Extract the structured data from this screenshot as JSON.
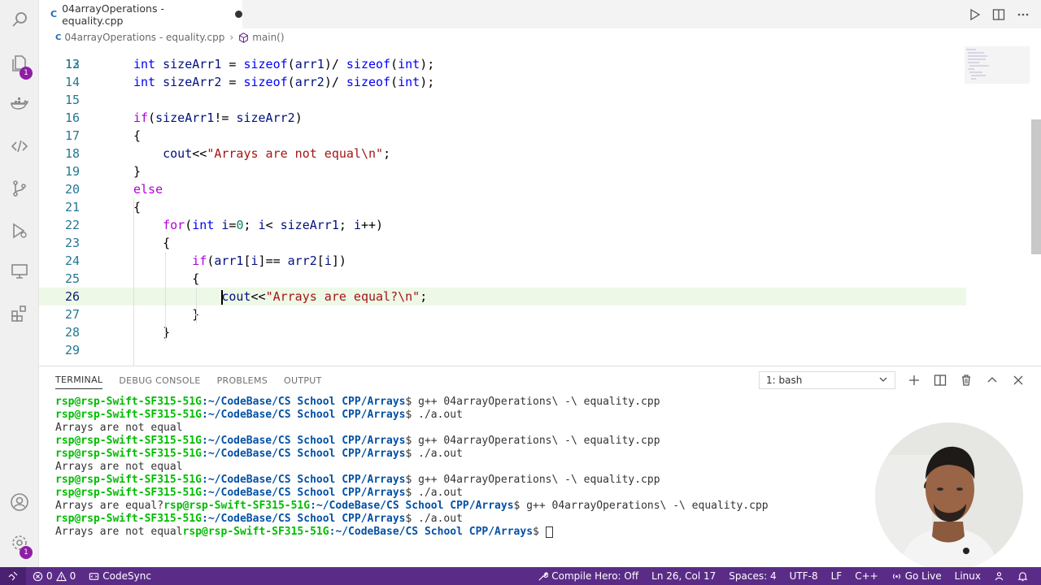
{
  "tab": {
    "icon": "C",
    "title": "04arrayOperations - equality.cpp"
  },
  "breadcrumb": {
    "file": "04arrayOperations - equality.cpp",
    "symbol": "main()"
  },
  "editor": {
    "top_partial": "12",
    "lines": [
      {
        "n": "13",
        "t": "int sizeArr1 = sizeof(arr1)/ sizeof(int);"
      },
      {
        "n": "14",
        "t": "int sizeArr2 = sizeof(arr2)/ sizeof(int);"
      },
      {
        "n": "15",
        "t": ""
      },
      {
        "n": "16",
        "t": "if(sizeArr1!= sizeArr2)"
      },
      {
        "n": "17",
        "t": "{"
      },
      {
        "n": "18",
        "t": "    cout<<\"Arrays are not equal\\n\";"
      },
      {
        "n": "19",
        "t": "}"
      },
      {
        "n": "20",
        "t": "else"
      },
      {
        "n": "21",
        "t": "{"
      },
      {
        "n": "22",
        "t": "    for(int i=0; i< sizeArr1; i++)"
      },
      {
        "n": "23",
        "t": "    {"
      },
      {
        "n": "24",
        "t": "        if(arr1[i]== arr2[i])"
      },
      {
        "n": "25",
        "t": "        {"
      },
      {
        "n": "26",
        "t": "            cout<<\"Arrays are equal?\\n\";"
      },
      {
        "n": "27",
        "t": "        }"
      },
      {
        "n": "28",
        "t": "    }"
      },
      {
        "n": "29",
        "t": ""
      }
    ],
    "current_line": "26"
  },
  "panel": {
    "tabs": [
      "TERMINAL",
      "DEBUG CONSOLE",
      "PROBLEMS",
      "OUTPUT"
    ],
    "active_tab": "TERMINAL",
    "terminal_select": "1: bash"
  },
  "terminal": {
    "prompt": "rsp@rsp-Swift-SF315-51G",
    "path": ":~/CodeBase/CS School CPP/Arrays",
    "lines": [
      {
        "pre": "",
        "cmd": "$ g++ 04arrayOperations\\ -\\ equality.cpp"
      },
      {
        "pre": "",
        "cmd": "$ ./a.out"
      },
      {
        "out": "Arrays are not equal"
      },
      {
        "pre": "",
        "cmd": "$ g++ 04arrayOperations\\ -\\ equality.cpp"
      },
      {
        "pre": "",
        "cmd": "$ ./a.out"
      },
      {
        "out": "Arrays are not equal"
      },
      {
        "pre": "",
        "cmd": "$ g++ 04arrayOperations\\ -\\ equality.cpp"
      },
      {
        "pre": "",
        "cmd": "$ ./a.out"
      },
      {
        "pre": "Arrays are equal?",
        "cmd": "$ g++ 04arrayOperations\\ -\\ equality.cpp"
      },
      {
        "pre": "",
        "cmd": "$ ./a.out"
      },
      {
        "pre": "Arrays are not equal",
        "cmd": "$ ",
        "cursor": true
      }
    ]
  },
  "activity": {
    "explorer_badge": "1",
    "manage_badge": "1"
  },
  "status": {
    "errors": "0",
    "warnings": "0",
    "codesync": "CodeSync",
    "compile_hero": "Compile Hero: Off",
    "position": "Ln 26, Col 17",
    "spaces": "Spaces: 4",
    "encoding": "UTF-8",
    "eol": "LF",
    "language": "C++",
    "golive": "Go Live",
    "os": "Linux"
  },
  "colors": {
    "status_bar": "#5b2c87",
    "prompt_green": "#00bc00",
    "path_blue": "#0451a5",
    "current_line_highlight": "#eef8e6"
  }
}
